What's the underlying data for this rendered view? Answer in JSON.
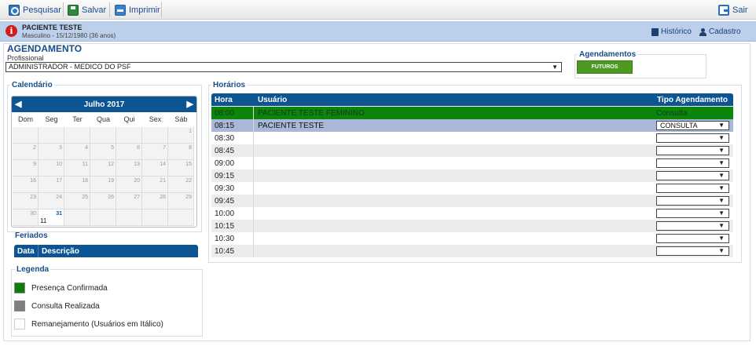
{
  "toolbar": {
    "pesquisar": "Pesquisar",
    "salvar": "Salvar",
    "imprimir": "Imprimir",
    "sair": "Sair"
  },
  "patient": {
    "name": "PACIENTE TESTE",
    "details": "Masculino - 15/12/1980 (36 anos)",
    "historico": "Histórico",
    "cadastro": "Cadastro"
  },
  "agendamento": {
    "title": "AGENDAMENTO",
    "profissional_label": "Profissional",
    "profissional_value": "ADMINISTRADOR - MEDICO DO PSF",
    "agendamentos_title": "Agendamentos",
    "futuros_button": "FUTUROS"
  },
  "calendar": {
    "title": "Calendário",
    "month": "Julho 2017",
    "prev": "◀",
    "next": "▶",
    "weekdays": [
      "Dom",
      "Seg",
      "Ter",
      "Qua",
      "Qui",
      "Sex",
      "Sáb"
    ],
    "weeks": [
      [
        "",
        "",
        "",
        "",
        "",
        "",
        "1"
      ],
      [
        "2",
        "3",
        "4",
        "5",
        "6",
        "7",
        "8"
      ],
      [
        "9",
        "10",
        "11",
        "12",
        "13",
        "14",
        "15"
      ],
      [
        "16",
        "17",
        "18",
        "19",
        "20",
        "21",
        "22"
      ],
      [
        "23",
        "24",
        "25",
        "26",
        "27",
        "28",
        "29"
      ],
      [
        "30",
        "31",
        "",
        "",
        "",
        "",
        ""
      ]
    ],
    "selected_day": "31",
    "selected_count": "11"
  },
  "feriados": {
    "title": "Feriados",
    "col_data": "Data",
    "col_descricao": "Descrição"
  },
  "legenda": {
    "title": "Legenda",
    "items": [
      {
        "label": "Presença Confirmada",
        "color": "#0a7d0a"
      },
      {
        "label": "Consulta Realizada",
        "color": "#7f7f7f"
      },
      {
        "label": "Remanejamento (Usuários em Itálico)",
        "color": "#ffffff"
      }
    ]
  },
  "horarios": {
    "title": "Horários",
    "col_hora": "Hora",
    "col_usuario": "Usuário",
    "col_tipo": "Tipo Agendamento",
    "rows": [
      {
        "hora": "08:00",
        "usuario": "PACIENTE TESTE FEMININO",
        "tipo": "Consulta",
        "style": "green",
        "select": false
      },
      {
        "hora": "08:15",
        "usuario": "PACIENTE TESTE",
        "tipo": "CONSULTA",
        "style": "blue",
        "select": true
      },
      {
        "hora": "08:30",
        "usuario": "",
        "tipo": "",
        "style": "odd",
        "select": true
      },
      {
        "hora": "08:45",
        "usuario": "",
        "tipo": "",
        "style": "even",
        "select": true
      },
      {
        "hora": "09:00",
        "usuario": "",
        "tipo": "",
        "style": "odd",
        "select": true
      },
      {
        "hora": "09:15",
        "usuario": "",
        "tipo": "",
        "style": "even",
        "select": true
      },
      {
        "hora": "09:30",
        "usuario": "",
        "tipo": "",
        "style": "odd",
        "select": true
      },
      {
        "hora": "09:45",
        "usuario": "",
        "tipo": "",
        "style": "even",
        "select": true
      },
      {
        "hora": "10:00",
        "usuario": "",
        "tipo": "",
        "style": "odd",
        "select": true
      },
      {
        "hora": "10:15",
        "usuario": "",
        "tipo": "",
        "style": "even",
        "select": true
      },
      {
        "hora": "10:30",
        "usuario": "",
        "tipo": "",
        "style": "odd",
        "select": true
      },
      {
        "hora": "10:45",
        "usuario": "",
        "tipo": "",
        "style": "even",
        "select": true
      }
    ]
  },
  "icons": {
    "search": "search-icon",
    "save": "save-icon",
    "print": "print-icon",
    "exit": "exit-icon",
    "info": "info-icon",
    "history": "book-icon",
    "cadastro": "user-icon",
    "dropdown": "▼"
  },
  "colors": {
    "primary": "#0d5592",
    "patient_bar": "#bcd0ec",
    "futuros": "#4d9a23",
    "confirmed_row": "#0c850c",
    "selected_row": "#a8b8d6",
    "alert": "#d21b1b"
  }
}
